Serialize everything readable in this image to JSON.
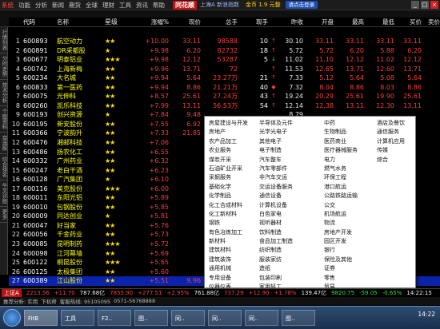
{
  "menu": [
    {
      "label": "系统",
      "sys": true
    },
    {
      "label": "功能"
    },
    {
      "label": "分析"
    },
    {
      "label": "新闻"
    },
    {
      "label": "期货"
    },
    {
      "label": "全球"
    },
    {
      "label": "理财"
    },
    {
      "label": "工具"
    },
    {
      "label": "资讯"
    },
    {
      "label": "帮助"
    }
  ],
  "app": {
    "logo": "同花顺",
    "title_info": "上海A 新浪指数",
    "cash": "金币 1.9 元整",
    "pill": "请点击登录"
  },
  "sidebar": [
    "行情列表",
    "分时走势",
    "技术分析",
    "个股资料",
    "自选股",
    "综合排名",
    "牛叉诊股",
    "更多"
  ],
  "columns": {
    "idx": "",
    "code": "代码",
    "name": "名称",
    "star": "星级",
    "pct": "涨幅%",
    "price": "现价",
    "cap": "总手",
    "amt": "现手",
    "prev": "昨收",
    "open": "开盘",
    "high": "最高",
    "low": "最低",
    "buy": "买价",
    "sell": "卖价"
  },
  "rows": [
    {
      "i": "1",
      "code": "600893",
      "name": "航空动力",
      "stars": "★★",
      "pct": "+10.00",
      "price": "33.11",
      "cap": "98588",
      "amt": "10",
      "arr": "↑",
      "prev": "30.10",
      "open": "33.11",
      "high": "33.11",
      "low": "33.11",
      "buy": "33.11",
      "sell": "",
      "d": "up"
    },
    {
      "i": "2",
      "code": "600891",
      "name": "DR采都股",
      "stars": "★",
      "pct": "+9.98",
      "price": "6.20",
      "cap": "82732",
      "amt": "18",
      "arr": "↑",
      "prev": "5.72",
      "open": "5.72",
      "high": "6.20",
      "low": "5.88",
      "buy": "6.20",
      "sell": "",
      "d": "up"
    },
    {
      "i": "3",
      "code": "600677",
      "name": "明泰铝业",
      "stars": "★★★",
      "pct": "+9.98",
      "price": "12.12",
      "cap": "53287",
      "amt": "5",
      "arr": "↓",
      "prev": "11.02",
      "open": "11.10",
      "high": "12.12",
      "low": "11.02",
      "buy": "12.12",
      "sell": "",
      "d": "up"
    },
    {
      "i": "4",
      "code": "600742",
      "name": "上海新梅",
      "stars": "★★",
      "pct": "+9.96",
      "price": "13.71",
      "cap": "72",
      "amt": "",
      "arr": "↑",
      "prev": "11.53",
      "open": "12.65",
      "high": "13.71",
      "low": "12.60",
      "buy": "13.71",
      "sell": "",
      "d": "up"
    },
    {
      "i": "5",
      "code": "600234",
      "name": "大名城",
      "stars": "★★",
      "pct": "+9.94",
      "price": "5.64",
      "cap": "23.27万",
      "amt": "21",
      "arr": "↑",
      "prev": "7.33",
      "open": "5.12",
      "high": "5.64",
      "low": "5.08",
      "buy": "5.64",
      "sell": "",
      "d": "up"
    },
    {
      "i": "6",
      "code": "600833",
      "name": "第一医药",
      "stars": "★★",
      "pct": "+9.94",
      "price": "8.86",
      "cap": "21.21万",
      "amt": "40",
      "arr": "◆",
      "prev": "7.32",
      "open": "8.04",
      "high": "8.86",
      "low": "8.03",
      "buy": "8.86",
      "sell": "",
      "d": "up"
    },
    {
      "i": "7",
      "code": "600075",
      "name": "光伸科",
      "stars": "★★",
      "pct": "+8.57",
      "price": "25.61",
      "cap": "27.24万",
      "amt": "43",
      "arr": "↑",
      "prev": "19.24",
      "open": "20.29",
      "high": "25.61",
      "low": "19.90",
      "buy": "25.61",
      "sell": "",
      "d": "up"
    },
    {
      "i": "8",
      "code": "600260",
      "name": "凯乐科技",
      "stars": "★★",
      "pct": "+7.99",
      "price": "13.11",
      "cap": "56.53万",
      "amt": "54",
      "arr": "↑",
      "prev": "12.14",
      "open": "12.38",
      "high": "13.11",
      "low": "12.30",
      "buy": "13.11",
      "sell": "",
      "d": "up"
    },
    {
      "i": "9",
      "code": "600193",
      "name": "创兴资源",
      "stars": "★",
      "pct": "+7.84",
      "price": "9.48",
      "cap": "",
      "amt": "",
      "arr": "",
      "prev": "8.79",
      "open": "",
      "high": "",
      "low": "",
      "buy": "",
      "sell": "",
      "d": "up"
    },
    {
      "i": "10",
      "code": "600195",
      "name": "新安股份",
      "stars": "★★",
      "pct": "+7.55",
      "price": "6.92",
      "cap": "",
      "amt": "",
      "arr": "",
      "prev": "",
      "open": "",
      "high": "",
      "low": "",
      "buy": "",
      "sell": "",
      "d": "up"
    },
    {
      "i": "11",
      "code": "600366",
      "name": "宁波韵升",
      "stars": "★★",
      "pct": "+7.33",
      "price": "21.85",
      "cap": "",
      "amt": "",
      "arr": "",
      "prev": "",
      "open": "",
      "high": "",
      "low": "",
      "buy": "",
      "sell": "",
      "d": "up"
    },
    {
      "i": "12",
      "code": "600476",
      "name": "湘邮科技",
      "stars": "★★",
      "pct": "+7.06",
      "price": "",
      "cap": "",
      "amt": "",
      "arr": "",
      "prev": "",
      "open": "",
      "high": "",
      "low": "",
      "buy": "",
      "sell": "",
      "d": "up"
    },
    {
      "i": "13",
      "code": "600486",
      "name": "扬农化工",
      "stars": "★★",
      "pct": "+6.55",
      "price": "",
      "cap": "",
      "amt": "",
      "arr": "",
      "prev": "",
      "open": "",
      "high": "",
      "low": "",
      "buy": "",
      "sell": "",
      "d": "up"
    },
    {
      "i": "14",
      "code": "600332",
      "name": "广州药业",
      "stars": "★★",
      "pct": "+6.32",
      "price": "",
      "cap": "",
      "amt": "",
      "arr": "",
      "prev": "",
      "open": "",
      "high": "",
      "low": "",
      "buy": "",
      "sell": "",
      "d": "up"
    },
    {
      "i": "15",
      "code": "600247",
      "name": "老白干酒",
      "stars": "★★",
      "pct": "+6.23",
      "price": "",
      "cap": "",
      "amt": "",
      "arr": "",
      "prev": "",
      "open": "",
      "high": "",
      "low": "",
      "buy": "",
      "sell": "",
      "d": "up"
    },
    {
      "i": "16",
      "code": "600128",
      "name": "广汽集团",
      "stars": "★",
      "pct": "+6.10",
      "price": "",
      "cap": "",
      "amt": "",
      "arr": "",
      "prev": "",
      "open": "",
      "high": "",
      "low": "",
      "buy": "",
      "sell": "",
      "d": "up"
    },
    {
      "i": "17",
      "code": "600116",
      "name": "美克股份",
      "stars": "★★★",
      "pct": "+6.00",
      "price": "",
      "cap": "",
      "amt": "",
      "arr": "",
      "prev": "",
      "open": "",
      "high": "",
      "low": "",
      "buy": "",
      "sell": "",
      "d": "up"
    },
    {
      "i": "18",
      "code": "600011",
      "name": "东阳光铝",
      "stars": "★★",
      "pct": "+5.89",
      "price": "",
      "cap": "",
      "amt": "",
      "arr": "",
      "prev": "",
      "open": "",
      "high": "",
      "low": "",
      "buy": "",
      "sell": "",
      "d": "up"
    },
    {
      "i": "19",
      "code": "600010",
      "name": "包钢股份",
      "stars": "★★",
      "pct": "+5.85",
      "price": "",
      "cap": "",
      "amt": "",
      "arr": "",
      "prev": "",
      "open": "",
      "high": "",
      "low": "",
      "buy": "",
      "sell": "",
      "d": "up"
    },
    {
      "i": "20",
      "code": "600009",
      "name": "同达创业",
      "stars": "★",
      "pct": "+5.81",
      "price": "",
      "cap": "",
      "amt": "",
      "arr": "",
      "prev": "",
      "open": "",
      "high": "",
      "low": "",
      "buy": "",
      "sell": "",
      "d": "up"
    },
    {
      "i": "21",
      "code": "600047",
      "name": "好当家",
      "stars": "★★",
      "pct": "+5.76",
      "price": "",
      "cap": "",
      "amt": "",
      "arr": "",
      "prev": "",
      "open": "",
      "high": "",
      "low": "",
      "buy": "",
      "sell": "",
      "d": "up"
    },
    {
      "i": "22",
      "code": "600056",
      "name": "千金药业",
      "stars": "★★",
      "pct": "+5.73",
      "price": "",
      "cap": "",
      "amt": "",
      "arr": "",
      "prev": "",
      "open": "",
      "high": "",
      "low": "",
      "buy": "",
      "sell": "",
      "d": "up"
    },
    {
      "i": "23",
      "code": "600085",
      "name": "昆明制药",
      "stars": "★★★",
      "pct": "+5.72",
      "price": "",
      "cap": "",
      "amt": "",
      "arr": "",
      "prev": "",
      "open": "",
      "high": "",
      "low": "",
      "buy": "",
      "sell": "",
      "d": "up"
    },
    {
      "i": "24",
      "code": "600098",
      "name": "江河幕墙",
      "stars": "★★",
      "pct": "+5.69",
      "price": "",
      "cap": "",
      "amt": "",
      "arr": "",
      "prev": "",
      "open": "",
      "high": "",
      "low": "",
      "buy": "",
      "sell": "",
      "d": "up"
    },
    {
      "i": "25",
      "code": "600122",
      "name": "桐昆股份",
      "stars": "★★★",
      "pct": "+5.65",
      "price": "",
      "cap": "",
      "amt": "",
      "arr": "",
      "prev": "",
      "open": "",
      "high": "",
      "low": "",
      "buy": "",
      "sell": "",
      "d": "up"
    },
    {
      "i": "26",
      "code": "600125",
      "name": "太极集团",
      "stars": "★★",
      "pct": "+5.60",
      "price": "",
      "cap": "",
      "amt": "",
      "arr": "",
      "prev": "",
      "open": "",
      "high": "",
      "low": "",
      "buy": "",
      "sell": "",
      "d": "up"
    },
    {
      "i": "27",
      "code": "600389",
      "name": "江山股份",
      "stars": "★★",
      "pct": "+5.51",
      "price": "9.96",
      "cap": "",
      "amt": "",
      "arr": "",
      "prev": "",
      "open": "",
      "high": "",
      "low": "",
      "buy": "",
      "sell": "",
      "d": "up",
      "sel": true
    }
  ],
  "popup": {
    "col1": [
      "房屋建设与开发",
      "房地产",
      "农产品加工",
      "农业服务",
      "煤炭开采",
      "石油矿业开采",
      "采掘服务",
      "基础化学",
      "化学制品",
      "化工合成材料",
      "化工新材料",
      "钢铁",
      "有色冶炼加工",
      "新材料",
      "建筑材料",
      "建筑装饰",
      "通用机械",
      "专用设备",
      "仪器仪表",
      "电气设备"
    ],
    "col2": [
      "半导体及元件",
      "光学光电子",
      "其他电子",
      "电子制造",
      "汽车整车",
      "汽车零部件",
      "非汽车交运",
      "交运设备服务",
      "通信设备",
      "计算机设备",
      "白色家电",
      "视听器材",
      "饮料制造",
      "食品加工制造",
      "纺织制造",
      "服装家纺",
      "造纸",
      "包装印刷",
      "家用轻工",
      "化学制药"
    ],
    "col3": [
      "中药",
      "生物制品",
      "医药商业",
      "医疗器械服务",
      "电力",
      "燃气水务",
      "环保工程",
      "港口航运",
      "公路铁路运输",
      "公交",
      "机场航运",
      "物流",
      "房地产开发",
      "园区开发",
      "银行",
      "保险及其他",
      "证券",
      "零售",
      "贸易",
      "景点及旅游"
    ],
    "col4": [
      "酒店及餐饮",
      "通信服务",
      "计算机应用",
      "传媒",
      "综合"
    ]
  },
  "status": {
    "label": "上证A",
    "index": "2213.56",
    "change": "+11.70",
    "turnover": "787.68亿",
    "sz_index": "7855.90",
    "sz_change": "+277.51",
    "sz_pct": "+2.95%",
    "sz_turnover": "761.88亿",
    "cy_index": "737.29",
    "cy_change": "+12.90",
    "cy_pct": "+1.78%",
    "cy_turnover": "139.47亿",
    "extra": "9820.75",
    "extra_change": "-59.05",
    "extra_pct": "-0.65%",
    "time": "14:22:15"
  },
  "info": {
    "hint": "推荐分析: 实用",
    "broker": "下机帮",
    "hotline": "客服热线: 95105095",
    "phone": "0571-56768888"
  },
  "taskbar": {
    "items": [
      "FitB",
      "工具",
      "F2..",
      "图..",
      "同..",
      "同..",
      "同..",
      "图.."
    ],
    "clock": "14:22"
  }
}
